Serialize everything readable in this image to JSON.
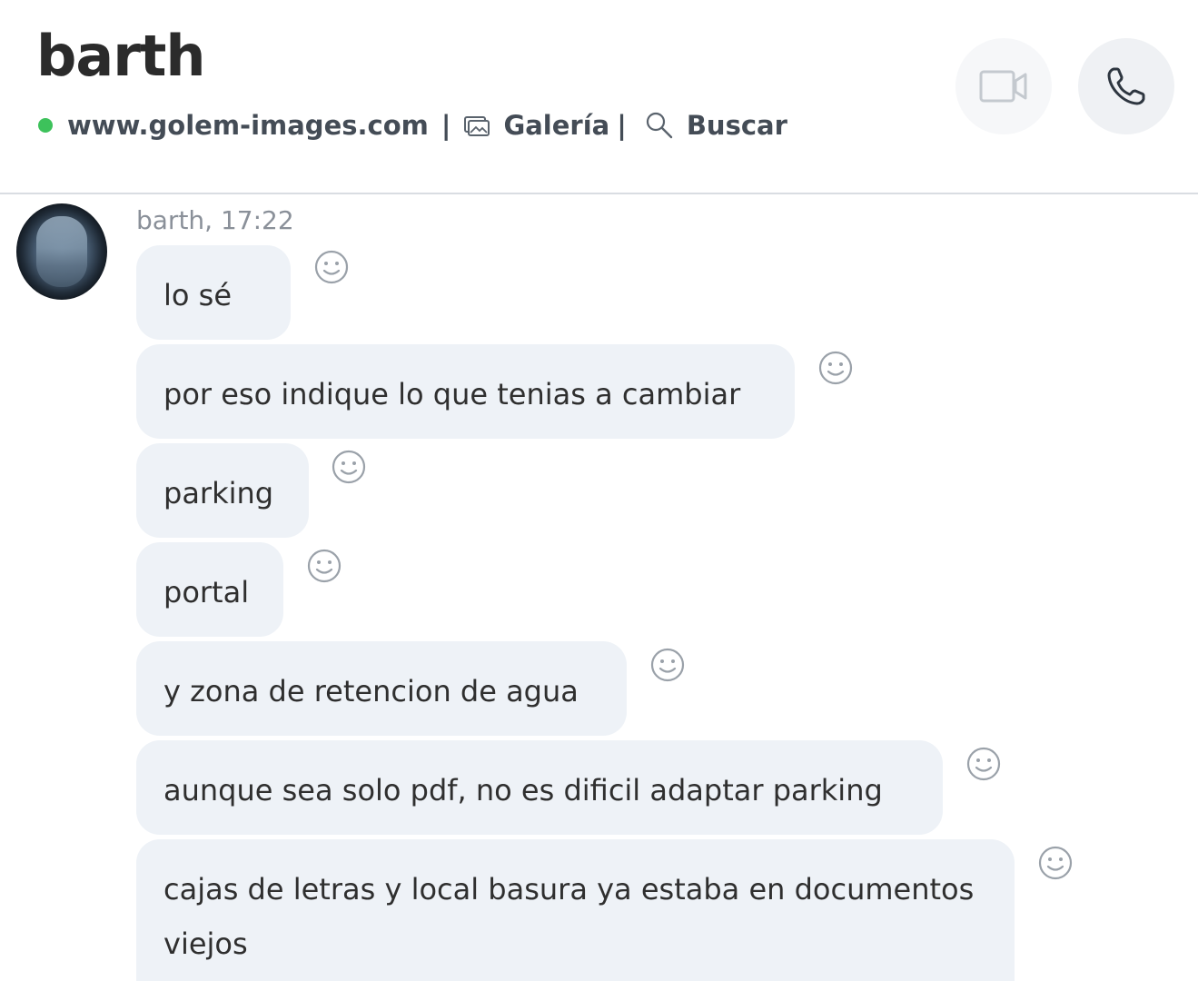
{
  "header": {
    "contact_name": "barth",
    "status_color": "#3dc25b",
    "website": "www.golem-images.com",
    "separator": "|",
    "gallery_label": "Galería",
    "search_label": "Buscar",
    "video_icon": "video-camera-icon",
    "call_icon": "phone-icon"
  },
  "conversation": {
    "sender_meta": "barth, 17:22",
    "messages": [
      {
        "text": "lo sé"
      },
      {
        "text": "por eso indique lo que tenias a cambiar"
      },
      {
        "text": "parking"
      },
      {
        "text": "portal"
      },
      {
        "text": "y zona de retencion de agua"
      },
      {
        "text": "aunque sea solo pdf, no es dificil adaptar parking"
      },
      {
        "text": "cajas de letras y local basura ya estaba en documentos viejos"
      }
    ],
    "reaction_icon": "smiley-icon"
  }
}
